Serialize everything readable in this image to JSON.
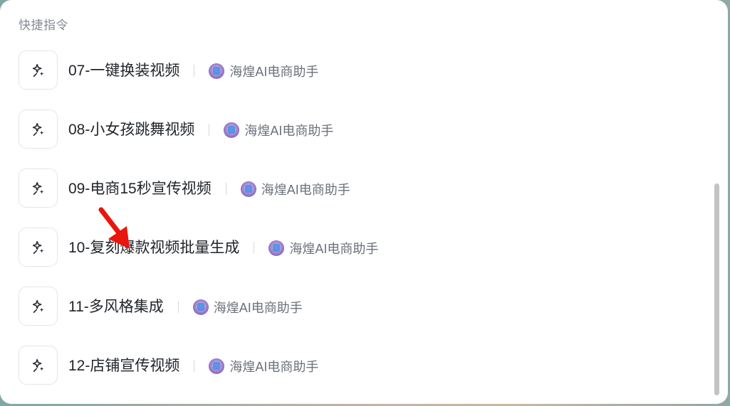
{
  "section_title": "快捷指令",
  "commands": [
    {
      "name": "07-一键换装视频",
      "bot": "海煌AI电商助手"
    },
    {
      "name": "08-小女孩跳舞视频",
      "bot": "海煌AI电商助手"
    },
    {
      "name": "09-电商15秒宣传视频",
      "bot": "海煌AI电商助手"
    },
    {
      "name": "10-复刻爆款视频批量生成",
      "bot": "海煌AI电商助手"
    },
    {
      "name": "11-多风格集成",
      "bot": "海煌AI电商助手"
    },
    {
      "name": "12-店铺宣传视频",
      "bot": "海煌AI电商助手"
    }
  ],
  "icons": {
    "command": "sparkle-pin-icon",
    "bot": "bot-avatar"
  },
  "colors": {
    "annotation_arrow": "#e8160c"
  }
}
